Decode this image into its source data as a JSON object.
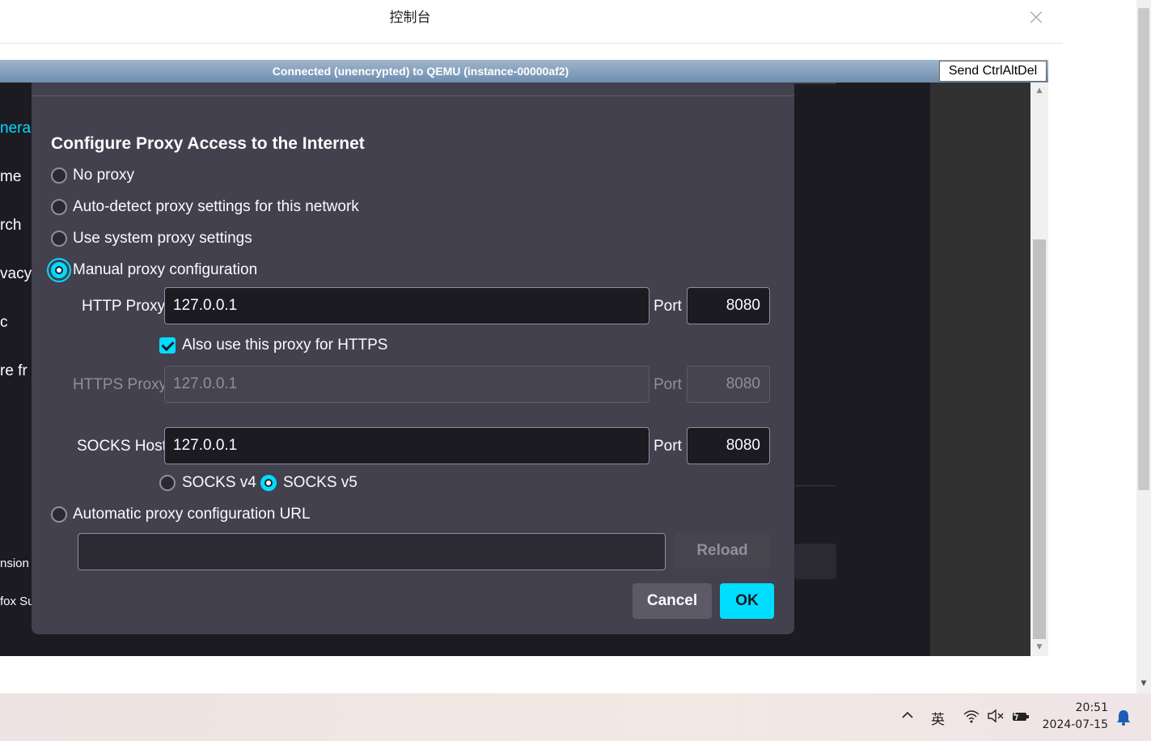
{
  "console": {
    "title": "控制台",
    "close_glyph": "×",
    "vnc_status": "Connected (unencrypted) to QEMU (instance-00000af2)",
    "send_cad_label": "Send CtrlAltDel"
  },
  "sidebar": {
    "items": [
      "neral",
      "me",
      "rch",
      "vacy",
      "c",
      "re fr",
      "nsion",
      "fox Su"
    ]
  },
  "proxy": {
    "heading": "Configure Proxy Access to the Internet",
    "options": {
      "no_proxy": "No proxy",
      "auto_detect": "Auto-detect proxy settings for this network",
      "use_system": "Use system proxy settings",
      "manual": "Manual proxy configuration",
      "auto_url": "Automatic proxy configuration URL"
    },
    "selected": "manual",
    "http_label": "HTTP Proxy",
    "http_value": "127.0.0.1",
    "http_port_label": "Port",
    "http_port": "8080",
    "also_https_label": "Also use this proxy for HTTPS",
    "also_https_checked": true,
    "https_label": "HTTPS Proxy",
    "https_value": "127.0.0.1",
    "https_port_label": "Port",
    "https_port": "8080",
    "socks_label": "SOCKS Host",
    "socks_value": "127.0.0.1",
    "socks_port_label": "Port",
    "socks_port": "8080",
    "socks_v4": "SOCKS v4",
    "socks_v5": "SOCKS v5",
    "socks_version_selected": "v5",
    "auto_url_value": "",
    "reload_label": "Reload",
    "cancel_label": "Cancel",
    "ok_label": "OK"
  },
  "colors": {
    "accent": "#00ddff",
    "dialog_bg": "#42414d",
    "page_bg": "#1c1b22"
  },
  "taskbar": {
    "ime": "英",
    "time": "20:51",
    "date": "2024-07-15",
    "icons": [
      "chevron-up-icon",
      "wifi-icon",
      "volume-muted-icon",
      "battery-charging-icon",
      "notification-bell-icon"
    ]
  }
}
